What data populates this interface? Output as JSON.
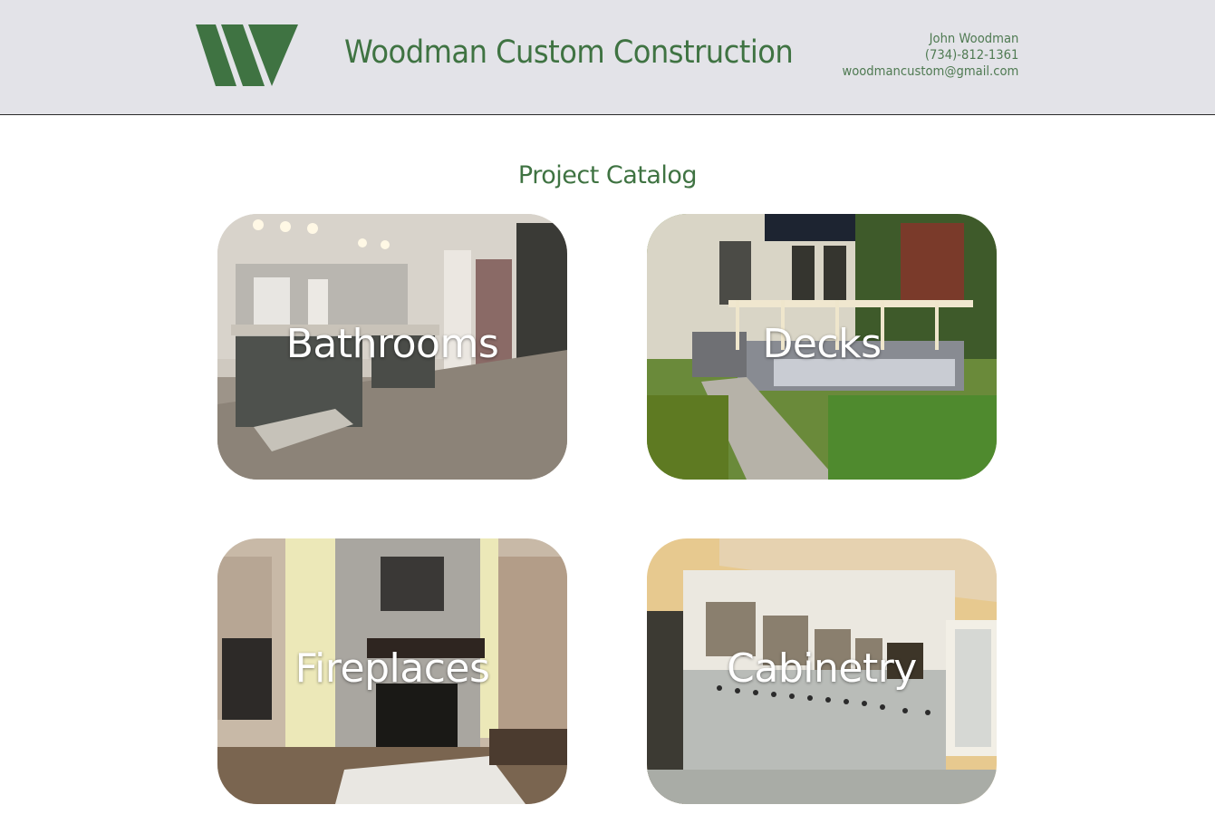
{
  "header": {
    "brand_name": "Woodman Custom Construction",
    "logo_icon": "woodman-w-logo",
    "contact": {
      "name": "John Woodman",
      "phone": "(734)-812-1361",
      "email": "woodmancustom@gmail.com"
    }
  },
  "main": {
    "title": "Project Catalog",
    "categories": [
      {
        "label": "Bathrooms"
      },
      {
        "label": "Decks"
      },
      {
        "label": "Fireplaces"
      },
      {
        "label": "Cabinetry"
      }
    ]
  },
  "colors": {
    "brand_green": "#3f7342",
    "header_bg": "#e3e3e8",
    "label_text": "#ffffff"
  }
}
